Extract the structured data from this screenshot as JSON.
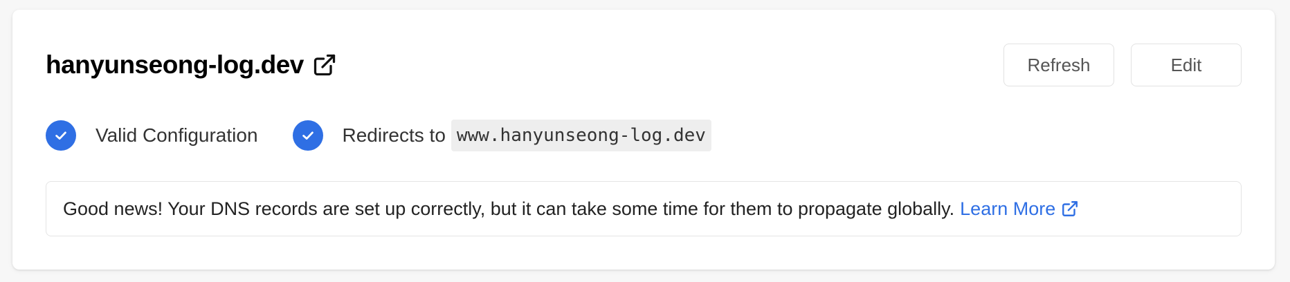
{
  "domain": {
    "name": "hanyunseong-log.dev",
    "external_icon": "external-link-icon"
  },
  "actions": {
    "refresh_label": "Refresh",
    "edit_label": "Edit"
  },
  "status": {
    "valid_label": "Valid Configuration",
    "redirect_label": "Redirects to",
    "redirect_target": "www.hanyunseong-log.dev",
    "check_icon": "check-circle-icon",
    "check_color": "#2f6fe4"
  },
  "notice": {
    "message": "Good news! Your DNS records are set up correctly, but it can take some time for them to propagate globally.",
    "link_label": "Learn More",
    "link_color": "#2f6fe4",
    "link_icon": "external-link-icon"
  }
}
